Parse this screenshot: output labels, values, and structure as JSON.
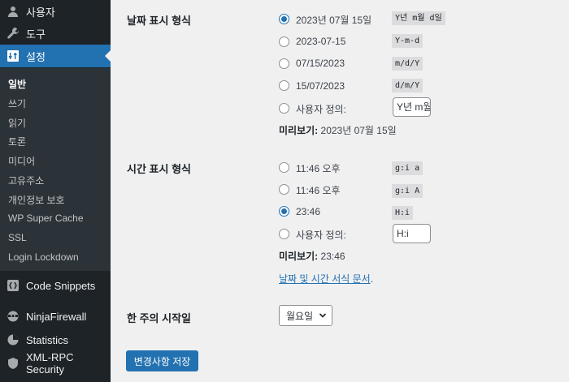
{
  "sidebar": {
    "menu": [
      {
        "label": "사용자",
        "icon": "users-icon"
      },
      {
        "label": "도구",
        "icon": "tools-icon"
      },
      {
        "label": "설정",
        "icon": "settings-icon",
        "active": true
      }
    ],
    "submenu": [
      "일반",
      "쓰기",
      "읽기",
      "토론",
      "미디어",
      "고유주소",
      "개인정보 보호",
      "WP Super Cache",
      "SSL",
      "Login Lockdown"
    ],
    "submenu_current": "일반",
    "plugins": [
      {
        "label": "Code Snippets",
        "icon": "code-snippets-icon"
      },
      {
        "label": "NinjaFirewall",
        "icon": "ninja-icon"
      },
      {
        "label": "Statistics",
        "icon": "statistics-icon"
      },
      {
        "label": "XML-RPC Security",
        "icon": "shield-icon"
      }
    ]
  },
  "date_format": {
    "label": "날짜 표시 형식",
    "options": [
      {
        "label": "2023년 07월 15일",
        "code": "Y년 m월 d일",
        "checked": true
      },
      {
        "label": "2023-07-15",
        "code": "Y-m-d",
        "checked": false
      },
      {
        "label": "07/15/2023",
        "code": "m/d/Y",
        "checked": false
      },
      {
        "label": "15/07/2023",
        "code": "d/m/Y",
        "checked": false
      }
    ],
    "custom_label": "사용자 정의:",
    "custom_value": "Y년 m월 d일",
    "preview_label": "미리보기:",
    "preview_value": "2023년 07월 15일"
  },
  "time_format": {
    "label": "시간 표시 형식",
    "options": [
      {
        "label": "11:46 오후",
        "code": "g:i a",
        "checked": false
      },
      {
        "label": "11:46 오후",
        "code": "g:i A",
        "checked": false
      },
      {
        "label": "23:46",
        "code": "H:i",
        "checked": true
      }
    ],
    "custom_label": "사용자 정의:",
    "custom_value": "H:i",
    "preview_label": "미리보기:",
    "preview_value": "23:46",
    "doc_link": "날짜 및 시간 서식 문서",
    "doc_link_suffix": "."
  },
  "week_start": {
    "label": "한 주의 시작일",
    "value": "월요일"
  },
  "save_button": "변경사항 저장",
  "colors": {
    "sidebar_bg": "#1d2327",
    "submenu_bg": "#2c3338",
    "accent": "#2271b1",
    "content_bg": "#f0f0f1"
  }
}
